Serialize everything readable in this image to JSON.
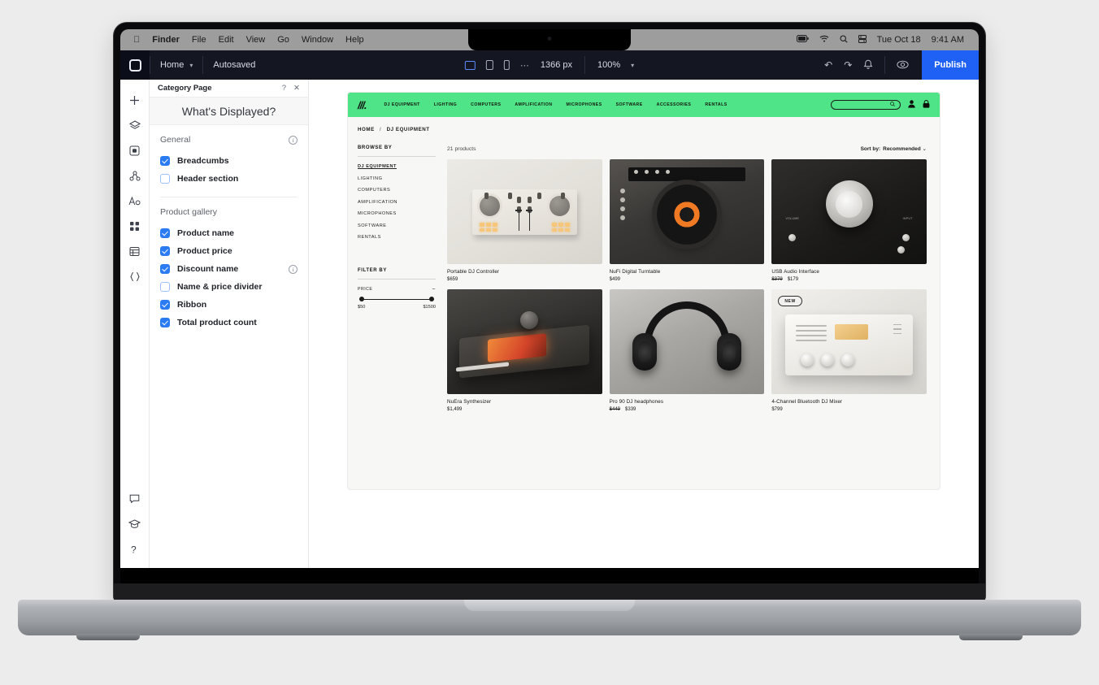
{
  "os_menubar": {
    "apple_icon": "apple-icon",
    "app_name": "Finder",
    "menus": [
      "File",
      "Edit",
      "View",
      "Go",
      "Window",
      "Help"
    ],
    "status_icons": [
      "battery-icon",
      "wifi-icon",
      "search-icon",
      "control-center-icon"
    ],
    "date": "Tue Oct 18",
    "time": "9:41 AM"
  },
  "editor": {
    "logo": "editor-logo-icon",
    "page_selector": "Home",
    "save_status": "Autosaved",
    "viewport": {
      "desktop_icon": "desktop-icon",
      "tablet_icon": "tablet-icon",
      "mobile_icon": "mobile-icon",
      "more_icon": "ellipsis-icon",
      "width": "1366 px",
      "zoom": "100%"
    },
    "actions": {
      "undo_icon": "undo-icon",
      "redo_icon": "redo-icon",
      "notifications_icon": "bell-icon",
      "preview_icon": "eye-icon",
      "publish_label": "Publish"
    }
  },
  "rail": {
    "items": [
      {
        "name": "add-icon",
        "glyph": "plus"
      },
      {
        "name": "layers-icon",
        "glyph": "layers"
      },
      {
        "name": "pages-icon",
        "glyph": "page"
      },
      {
        "name": "site-structure-icon",
        "glyph": "structure"
      },
      {
        "name": "text-style-icon",
        "glyph": "text"
      },
      {
        "name": "apps-icon",
        "glyph": "grid"
      },
      {
        "name": "database-icon",
        "glyph": "table"
      },
      {
        "name": "dev-mode-icon",
        "glyph": "code"
      }
    ],
    "bottom_items": [
      {
        "name": "comments-icon",
        "glyph": "comment"
      },
      {
        "name": "learn-icon",
        "glyph": "cap"
      },
      {
        "name": "help-icon",
        "glyph": "question"
      }
    ]
  },
  "panel": {
    "header": "Category Page",
    "help_icon": "question-mark-icon",
    "close_icon": "close-icon",
    "title": "What's Displayed?",
    "sections": [
      {
        "heading": "General",
        "has_info": true,
        "options": [
          {
            "label": "Breadcumbs",
            "checked": true,
            "info": false
          },
          {
            "label": "Header section",
            "checked": false,
            "info": false
          }
        ]
      },
      {
        "heading": "Product gallery",
        "has_info": false,
        "options": [
          {
            "label": "Product name",
            "checked": true,
            "info": false
          },
          {
            "label": "Product price",
            "checked": true,
            "info": false
          },
          {
            "label": "Discount name",
            "checked": true,
            "info": true
          },
          {
            "label": "Name & price divider",
            "checked": false,
            "info": false
          },
          {
            "label": "Ribbon",
            "checked": true,
            "info": false
          },
          {
            "label": "Total product count",
            "checked": true,
            "info": false
          }
        ]
      }
    ]
  },
  "site": {
    "nav": {
      "logo": "store-logo-icon",
      "accent_color": "#4FE487",
      "links": [
        "DJ EQUIPMENT",
        "LIGHTING",
        "COMPUTERS",
        "AMPLIFICATION",
        "MICROPHONES",
        "SOFTWARE",
        "ACCESSORIES",
        "RENTALS"
      ],
      "search_icon": "search-icon",
      "account_icon": "account-icon",
      "cart_icon": "cart-lock-icon"
    },
    "breadcrumb": {
      "home": "HOME",
      "separator": "/",
      "current": "DJ EQUIPMENT"
    },
    "browse": {
      "heading": "BROWSE BY",
      "categories": [
        "DJ EQUIPMENT",
        "LIGHTING",
        "COMPUTERS",
        "AMPLIFICATION",
        "MICROPHONES",
        "SOFTWARE",
        "RENTALS"
      ],
      "active": "DJ EQUIPMENT"
    },
    "filter": {
      "heading": "FILTER BY",
      "price_label": "PRICE",
      "collapse_icon": "minus-icon",
      "min": "$50",
      "max": "$1500"
    },
    "listing": {
      "count": "21 products",
      "sort_label": "Sort by:",
      "sort_value": "Recommended",
      "sort_caret": "chevron-down-icon"
    },
    "products": [
      {
        "name": "Portable DJ Controller",
        "price": "$659",
        "was": null,
        "ribbon": null,
        "art": "a-ctrl"
      },
      {
        "name": "NuFi Digital Turntable",
        "price": "$499",
        "was": null,
        "ribbon": null,
        "art": "a-turn"
      },
      {
        "name": "USB Audio Interface",
        "price": "$179",
        "was": "$379",
        "ribbon": null,
        "art": "a-usb"
      },
      {
        "name": "NuEra Synthesizer",
        "price": "$1,499",
        "was": null,
        "ribbon": null,
        "art": "a-synth"
      },
      {
        "name": "Pro 90 DJ headphones",
        "price": "$339",
        "was": "$449",
        "ribbon": null,
        "art": "a-hp"
      },
      {
        "name": "4-Channel Bluetooth DJ Mixer",
        "price": "$799",
        "was": null,
        "ribbon": "NEW",
        "art": "a-mix"
      }
    ]
  }
}
